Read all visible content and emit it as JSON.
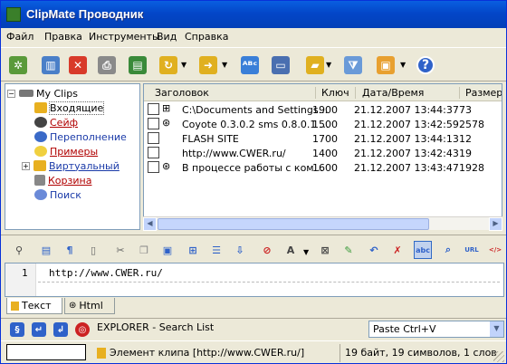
{
  "window": {
    "title": "ClipMate Проводник"
  },
  "menu": [
    "Файл",
    "Правка",
    "Инструменты",
    "Вид",
    "Справка"
  ],
  "tree": {
    "root": "My Clips",
    "items": [
      {
        "label": "Входящие",
        "color": "#000000"
      },
      {
        "label": "Сейф",
        "color": "#b00000"
      },
      {
        "label": "Переполнение",
        "color": "#1a3aa8"
      },
      {
        "label": "Примеры",
        "color": "#b00000"
      },
      {
        "label": "Виртуальный",
        "color": "#1a3aa8"
      },
      {
        "label": "Корзина",
        "color": "#b00000"
      },
      {
        "label": "Поиск",
        "color": "#1a3aa8"
      }
    ]
  },
  "list": {
    "columns": [
      "Заголовок",
      "Ключ",
      "Дата/Время",
      "Размер"
    ],
    "rows": [
      {
        "title": "C:\\Documents and Settings...",
        "key": "1900",
        "datetime": "21.12.2007 13:44:37",
        "size": "73"
      },
      {
        "title": "Coyote 0.3.0.2 sms 0.8.0.1 ...",
        "key": "1500",
        "datetime": "21.12.2007 13:42:59",
        "size": "2578"
      },
      {
        "title": "FLASH SITE",
        "key": "1700",
        "datetime": "21.12.2007 13:44:13",
        "size": "12"
      },
      {
        "title": "http://www.CWER.ru/",
        "key": "1400",
        "datetime": "21.12.2007 13:42:43",
        "size": "19"
      },
      {
        "title": "В процессе работы с ком...",
        "key": "1600",
        "datetime": "21.12.2007 13:43:47",
        "size": "1928"
      }
    ]
  },
  "editor": {
    "line_number": "1",
    "content": "http://www.CWER.ru/"
  },
  "tabs": [
    "Текст",
    "Html"
  ],
  "bottom": {
    "label": "EXPLORER - Search List",
    "hotkey": "Paste Ctrl+V"
  },
  "status": {
    "clip": "Элемент клипа [http://www.CWER.ru/]",
    "info": "19 байт, 19 символов, 1 слов"
  },
  "colors": {
    "title_bar": "#0a5fe0",
    "selection_red": "#b00000",
    "link_blue": "#1a3aa8"
  }
}
